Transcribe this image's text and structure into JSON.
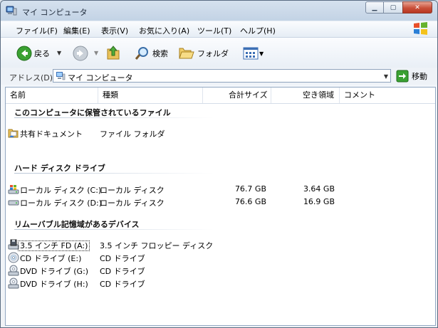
{
  "window": {
    "title": "マイ コンピュータ"
  },
  "menu": [
    "ファイル(F)",
    "編集(E)",
    "表示(V)",
    "お気に入り(A)",
    "ツール(T)",
    "ヘルプ(H)"
  ],
  "toolbar": {
    "back_label": "戻る",
    "search_label": "検索",
    "folders_label": "フォルダ"
  },
  "address": {
    "label": "アドレス(D)",
    "value": "マイ コンピュータ",
    "go_label": "移動"
  },
  "columns": {
    "name": "名前",
    "type": "種類",
    "total": "合計サイズ",
    "free": "空き領域",
    "comment": "コメント"
  },
  "groups": [
    {
      "title": "このコンピュータに保管されているファイル",
      "items": [
        {
          "icon": "shared-documents-icon",
          "name": "共有ドキュメント",
          "type": "ファイル フォルダ",
          "total": "",
          "free": ""
        }
      ]
    },
    {
      "title": "ハード ディスク ドライブ",
      "items": [
        {
          "icon": "system-drive-icon",
          "name": "ローカル ディスク (C:)",
          "type": "ローカル ディスク",
          "total": "76.7 GB",
          "free": "3.64 GB"
        },
        {
          "icon": "hard-drive-icon",
          "name": "ローカル ディスク (D:)",
          "type": "ローカル ディスク",
          "total": "76.6 GB",
          "free": "16.9 GB"
        }
      ]
    },
    {
      "title": "リムーバブル記憶域があるデバイス",
      "items": [
        {
          "icon": "floppy-drive-icon",
          "name": "3.5 インチ FD (A:)",
          "type": "3.5 インチ フロッピー ディスク",
          "total": "",
          "free": ""
        },
        {
          "icon": "cd-drive-icon",
          "name": "CD ドライブ (E:)",
          "type": "CD ドライブ",
          "total": "",
          "free": ""
        },
        {
          "icon": "dvd-drive-icon",
          "name": "DVD ドライブ (G:)",
          "type": "CD ドライブ",
          "total": "",
          "free": ""
        },
        {
          "icon": "dvd-drive-icon",
          "name": "DVD ドライブ (H:)",
          "type": "CD ドライブ",
          "total": "",
          "free": ""
        }
      ]
    }
  ]
}
